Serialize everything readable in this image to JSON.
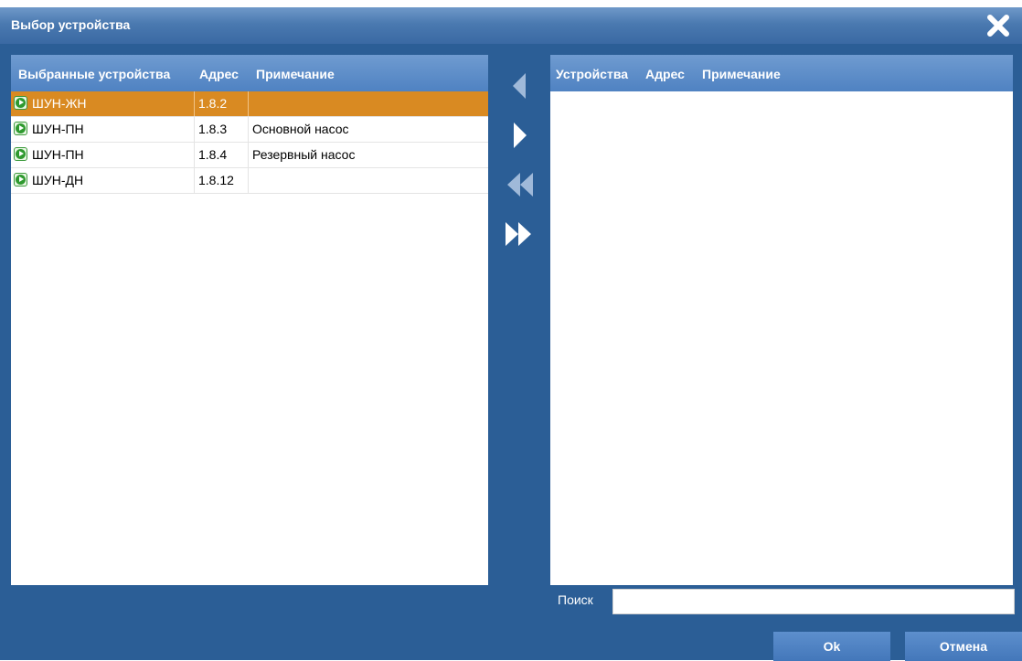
{
  "dialog": {
    "title": "Выбор устройства",
    "icons": {
      "close": "close-icon"
    }
  },
  "left_panel": {
    "columns": [
      "Выбранные устройства",
      "Адрес",
      "Примечание"
    ],
    "rows": [
      {
        "name": "ШУН-ЖН",
        "address": "1.8.2",
        "note": "",
        "selected": true,
        "icon": "play-circle-icon"
      },
      {
        "name": "ШУН-ПН",
        "address": "1.8.3",
        "note": "Основной насос",
        "selected": false,
        "icon": "play-circle-icon"
      },
      {
        "name": "ШУН-ПН",
        "address": "1.8.4",
        "note": "Резервный насос",
        "selected": false,
        "icon": "play-circle-icon"
      },
      {
        "name": "ШУН-ДН",
        "address": "1.8.12",
        "note": "",
        "selected": false,
        "icon": "play-circle-icon"
      }
    ]
  },
  "right_panel": {
    "columns": [
      "Устройства",
      "Адрес",
      "Примечание"
    ],
    "rows": []
  },
  "transfer_buttons": {
    "move_left": "arrow-left-icon",
    "move_right": "arrow-right-icon",
    "move_all_left": "double-arrow-left-icon",
    "move_all_right": "double-arrow-right-icon"
  },
  "search": {
    "label": "Поиск",
    "value": "",
    "placeholder": ""
  },
  "footer": {
    "ok_label": "Ok",
    "cancel_label": "Отмена"
  },
  "colors": {
    "dialog_background": "#2b5e96",
    "header_gradient": "#4f82c2",
    "selected_row": "#d98a22",
    "row_icon": "#2f9a2f"
  }
}
